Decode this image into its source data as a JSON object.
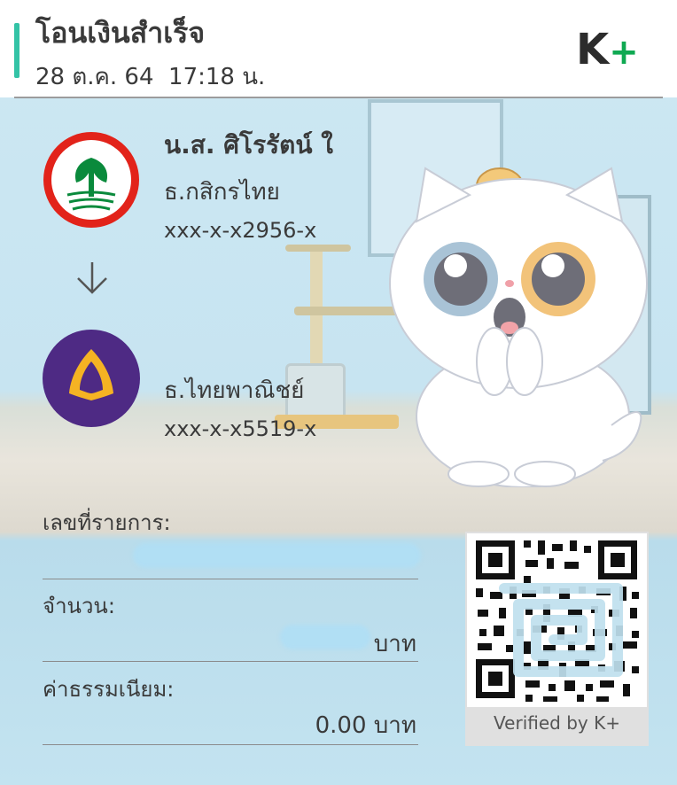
{
  "header": {
    "title": "โอนเงินสำเร็จ",
    "datetime": "28 ต.ค. 64  17:18 น.",
    "logo_k": "K",
    "logo_plus": "+"
  },
  "sender": {
    "name": "น.ส. ศิโรรัตน์ ใ",
    "bank": "ธ.กสิกรไทย",
    "account": "xxx-x-x2956-x",
    "logo_color": "#e2231a",
    "logo_icon": "kasikorn-bank-logo"
  },
  "receiver": {
    "name": "",
    "bank": "ธ.ไทยพาณิชย์",
    "account": "xxx-x-x5519-x",
    "logo_color": "#4e2a84",
    "logo_icon": "scb-bank-logo"
  },
  "details": {
    "ref_label": "เลขที่รายการ:",
    "amount_label": "จำนวน:",
    "amount_value": "บาท",
    "fee_label": "ค่าธรรมเนียม:",
    "fee_value": "0.00 บาท"
  },
  "qr": {
    "caption": "Verified by K+"
  },
  "colors": {
    "accent": "#33c3a6",
    "brand_green": "#0fa952"
  }
}
